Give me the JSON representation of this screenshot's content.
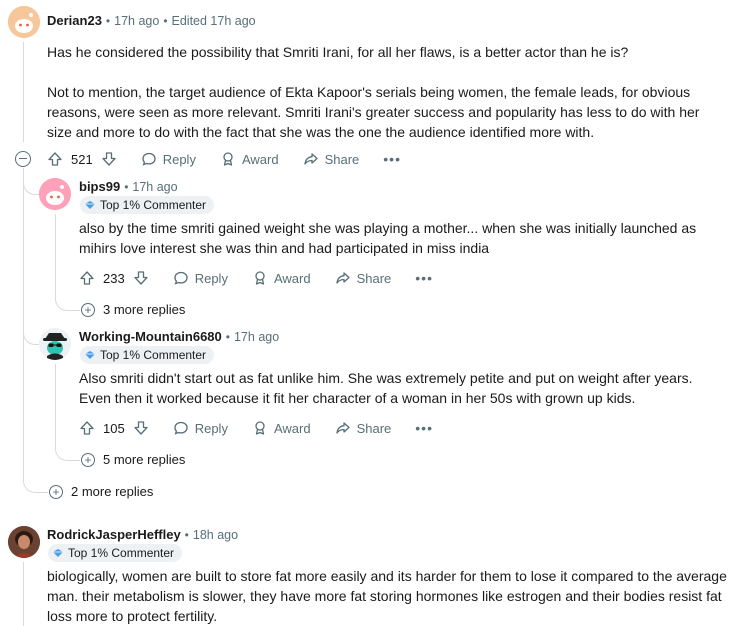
{
  "comments": [
    {
      "username": "Derian23",
      "time": "17h ago",
      "edited": "Edited 17h ago",
      "paragraphs": [
        "Has he considered the possibility that Smriti Irani, for all her flaws, is a better actor than he is?",
        "Not to mention, the target audience of Ekta Kapoor's serials being women, the female leads, for obvious reasons, were seen as more relevant. Smriti Irani's greater success and popularity has less to do with her size and more to do with the fact that she was the one the audience identified more with."
      ],
      "votes": "521",
      "more_replies": "2 more replies",
      "replies": [
        {
          "username": "bips99",
          "time": "17h ago",
          "badge": "Top 1% Commenter",
          "text": "also by the time smriti gained weight she was playing a mother... when she was initially launched as mihirs love interest she was thin and had participated in miss india",
          "votes": "233",
          "more_replies": "3 more replies"
        },
        {
          "username": "Working-Mountain6680",
          "time": "17h ago",
          "badge": "Top 1% Commenter",
          "text": "Also smriti didn't start out as fat unlike him. She was extremely petite and put on weight after years. Even then it worked because it fit her character of a woman in her 50s with grown up kids.",
          "votes": "105",
          "more_replies": "5 more replies"
        }
      ]
    },
    {
      "username": "RodrickJasperHeffley",
      "time": "18h ago",
      "badge": "Top 1% Commenter",
      "text": "biologically, women are built to store fat more easily and its harder for them to lose it compared to the average man. their metabolism is slower, they have more fat storing hormones like estrogen and their bodies resist fat loss more to protect fertility."
    }
  ],
  "actions": {
    "reply": "Reply",
    "award": "Award",
    "share": "Share",
    "more": "•••"
  },
  "dot": "•",
  "colors": {
    "meta": "#576f76",
    "thread": "#d7dadc",
    "badge_bg": "#eef1f3"
  }
}
